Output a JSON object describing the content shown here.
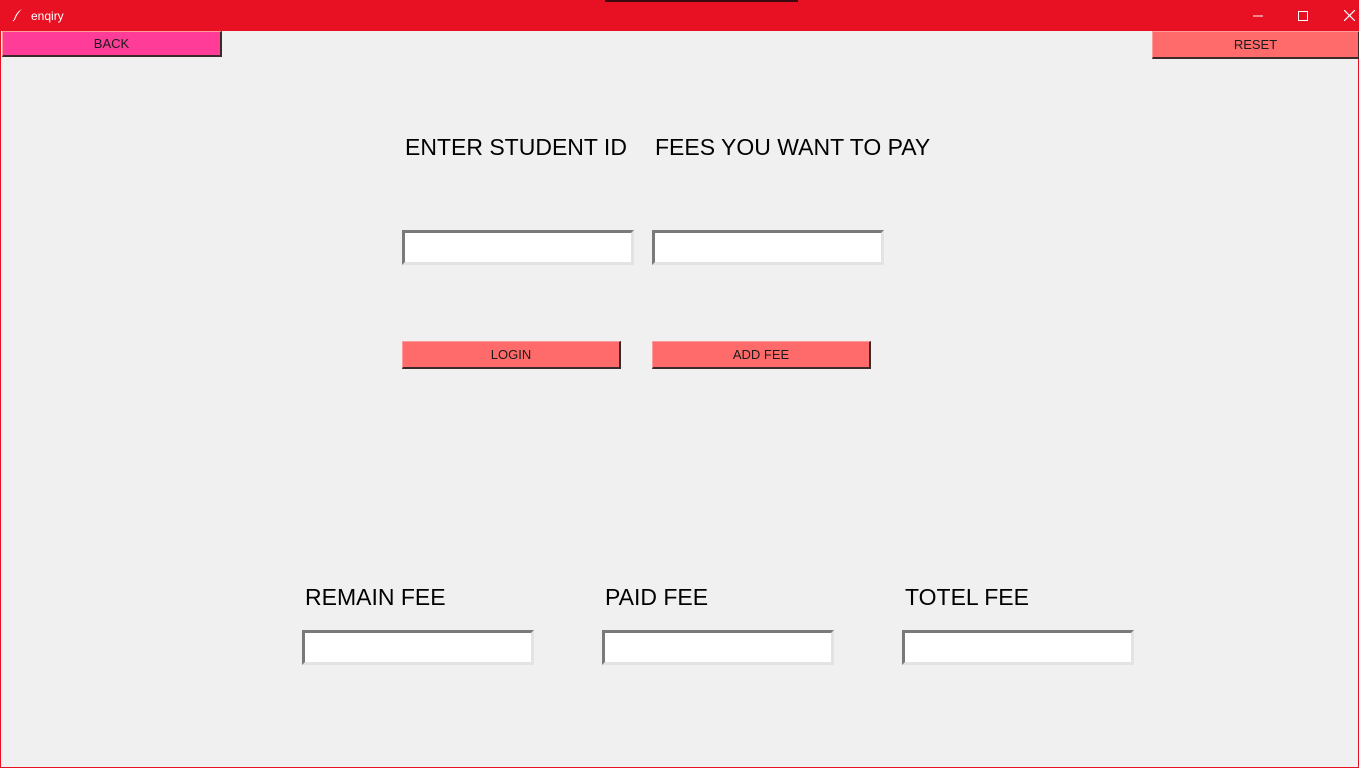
{
  "window": {
    "title": "enqiry",
    "accent_color": "#e81123"
  },
  "titlebar": {
    "minimize_icon": "minimize-icon",
    "maximize_icon": "maximize-icon",
    "close_icon": "close-icon",
    "app_icon": "feather-icon"
  },
  "toolbar": {
    "back_label": "BACK",
    "back_color": "#ff3c97",
    "reset_label": "RESET",
    "reset_color": "#ff6b6b"
  },
  "form": {
    "student_id_label": "ENTER STUDENT ID",
    "student_id_value": "",
    "fees_label": "FEES YOU WANT TO PAY",
    "fees_value": "",
    "login_label": "LOGIN",
    "add_fee_label": "ADD FEE",
    "button_color": "#ff6b6b"
  },
  "summary": {
    "remain_label": "REMAIN FEE",
    "remain_value": "",
    "paid_label": "PAID FEE",
    "paid_value": "",
    "totel_label": "TOTEL FEE",
    "totel_value": ""
  }
}
